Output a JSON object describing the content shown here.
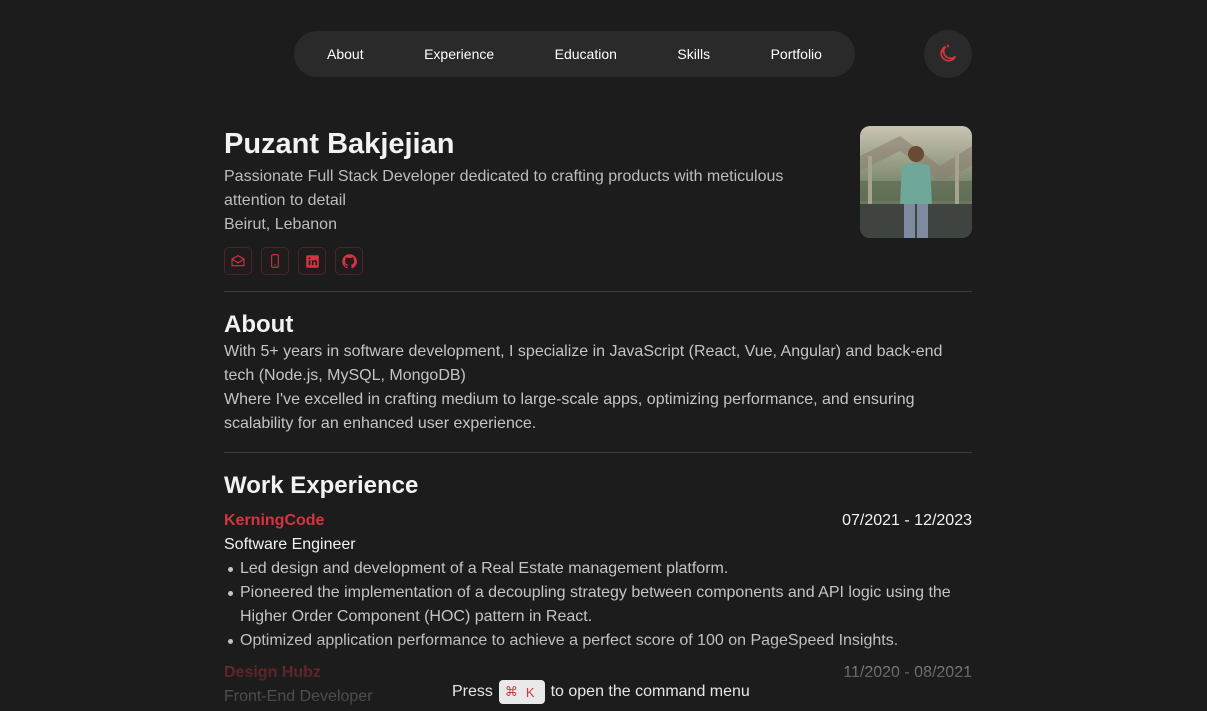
{
  "nav": {
    "items": [
      {
        "label": "About"
      },
      {
        "label": "Experience"
      },
      {
        "label": "Education"
      },
      {
        "label": "Skills"
      },
      {
        "label": "Portfolio"
      }
    ],
    "theme_icon": "moon-sun-icon"
  },
  "profile": {
    "name": "Puzant Bakjejian",
    "tagline": "Passionate Full Stack Developer dedicated to crafting products with meticulous attention to detail",
    "location": " Beirut, Lebanon",
    "socials": [
      {
        "icon": "mail-icon"
      },
      {
        "icon": "phone-icon"
      },
      {
        "icon": "linkedin-icon"
      },
      {
        "icon": "github-icon"
      }
    ]
  },
  "about": {
    "title": "About",
    "line1": "With 5+ years in software development, I specialize in JavaScript (React, Vue, Angular) and back-end tech (Node.js, MySQL, MongoDB)",
    "line2": "Where I've excelled in crafting medium to large-scale apps, optimizing performance, and ensuring scalability for an enhanced user experience."
  },
  "experience": {
    "title": "Work Experience",
    "jobs": [
      {
        "company": "KerningCode",
        "dates": "07/2021 - 12/2023",
        "role": "Software Engineer",
        "bullets": [
          "Led design and development of a Real Estate management platform.",
          "Pioneered the implementation of a decoupling strategy between components and API logic using the Higher Order Component (HOC) pattern in React.",
          "Optimized application performance to achieve a perfect score of 100 on PageSpeed Insights."
        ]
      },
      {
        "company": "Design Hubz",
        "dates": "11/2020 - 08/2021",
        "role": "Front-End Developer"
      }
    ]
  },
  "command_hint": {
    "prefix": "Press",
    "key_symbol": "⌘",
    "key": "K",
    "suffix": "to open the command menu"
  },
  "colors": {
    "background": "#1c1c1d",
    "accent": "#d6343f",
    "surface": "#2a2a2b"
  }
}
